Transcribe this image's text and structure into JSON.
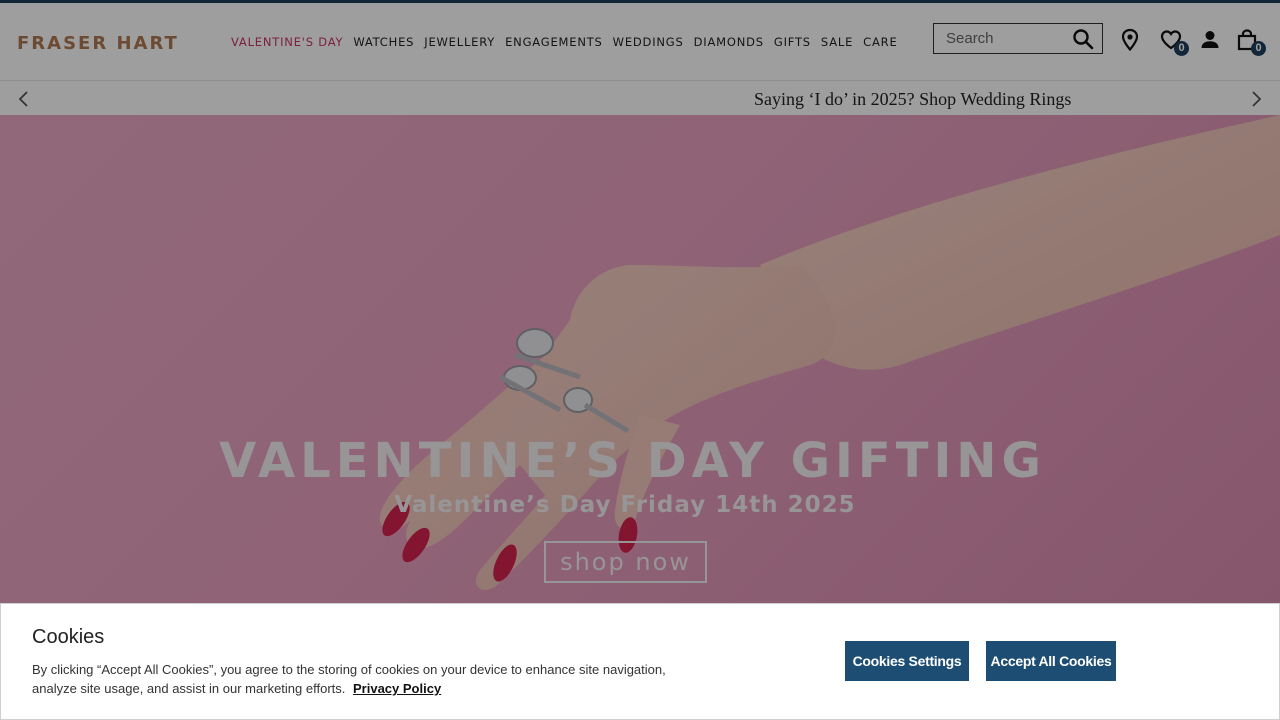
{
  "brand": {
    "name": "FRASER HART"
  },
  "nav": {
    "items": [
      {
        "label": "VALENTINE'S DAY",
        "active": true
      },
      {
        "label": "WATCHES"
      },
      {
        "label": "JEWELLERY"
      },
      {
        "label": "ENGAGEMENTS"
      },
      {
        "label": "WEDDINGS"
      },
      {
        "label": "DIAMONDS"
      },
      {
        "label": "GIFTS"
      },
      {
        "label": "SALE"
      },
      {
        "label": "CARE"
      }
    ]
  },
  "search": {
    "placeholder": "Search",
    "icon": "search-icon"
  },
  "header_icons": {
    "store_locator": {
      "icon": "location-pin-icon"
    },
    "wishlist": {
      "icon": "heart-icon",
      "count": "0"
    },
    "account": {
      "icon": "user-icon"
    },
    "bag": {
      "icon": "shopping-bag-icon",
      "count": "0"
    }
  },
  "promo": {
    "text": "Saying ‘I do’ in 2025? Shop Wedding Rings"
  },
  "hero": {
    "title": "VALENTINE’S DAY GIFTING",
    "subtitle": "Valentine’s Day Friday 14th 2025",
    "cta": "shop now"
  },
  "cookie": {
    "title": "Cookies",
    "body": "By clicking “Accept All Cookies”, you agree to the storing of cookies on your device to enhance site navigation, analyze site usage, and assist in our marketing efforts.",
    "privacy_link": "Privacy Policy",
    "settings_button": "Cookies Settings",
    "accept_button": "Accept All Cookies"
  },
  "colors": {
    "brand": "#b07a52",
    "accent": "#c8326a",
    "navy": "#1d3c5c",
    "cookie_button": "#1d4d73",
    "hero_bg": "#e8a0bf"
  }
}
